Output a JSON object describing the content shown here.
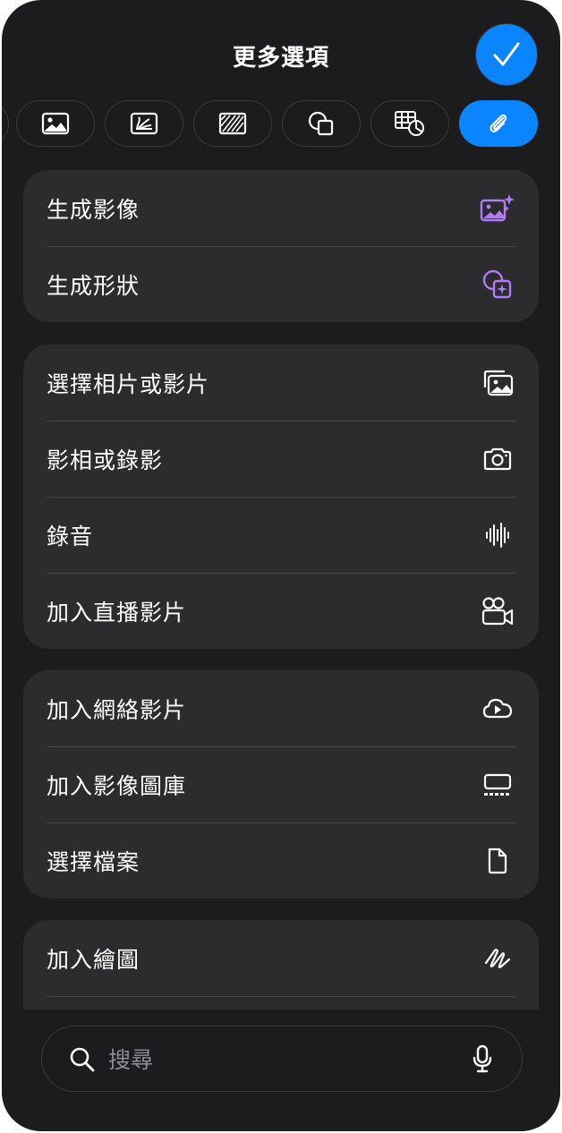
{
  "header": {
    "title": "更多選項",
    "done_label": "完成"
  },
  "tabs": [
    {
      "name": "image",
      "icon": "photo-icon",
      "active": false
    },
    {
      "name": "graphic",
      "icon": "graphic-icon",
      "active": false
    },
    {
      "name": "texture",
      "icon": "striped-square-icon",
      "active": false
    },
    {
      "name": "shape",
      "icon": "shapes-icon",
      "active": false
    },
    {
      "name": "table-chart",
      "icon": "table-chart-icon",
      "active": false
    },
    {
      "name": "attachment",
      "icon": "paperclip-icon",
      "active": true
    }
  ],
  "groups": [
    {
      "items": [
        {
          "label": "生成影像",
          "icon": "image-sparkle-icon"
        },
        {
          "label": "生成形狀",
          "icon": "shape-sparkle-icon"
        }
      ]
    },
    {
      "items": [
        {
          "label": "選擇相片或影片",
          "icon": "photos-icon"
        },
        {
          "label": "影相或錄影",
          "icon": "camera-icon"
        },
        {
          "label": "錄音",
          "icon": "waveform-icon"
        },
        {
          "label": "加入直播影片",
          "icon": "video-camera-icon"
        }
      ]
    },
    {
      "items": [
        {
          "label": "加入網絡影片",
          "icon": "cloud-play-icon"
        },
        {
          "label": "加入影像圖庫",
          "icon": "gallery-icon"
        },
        {
          "label": "選擇檔案",
          "icon": "document-icon"
        }
      ]
    },
    {
      "items": [
        {
          "label": "加入繪圖",
          "icon": "scribble-icon"
        }
      ]
    }
  ],
  "search": {
    "placeholder": "搜尋",
    "value": ""
  },
  "colors": {
    "accent": "#0a84ff",
    "ai_purple": "#b07cf5",
    "sheet_bg": "#1c1c1e",
    "group_bg": "#2c2c2e"
  }
}
